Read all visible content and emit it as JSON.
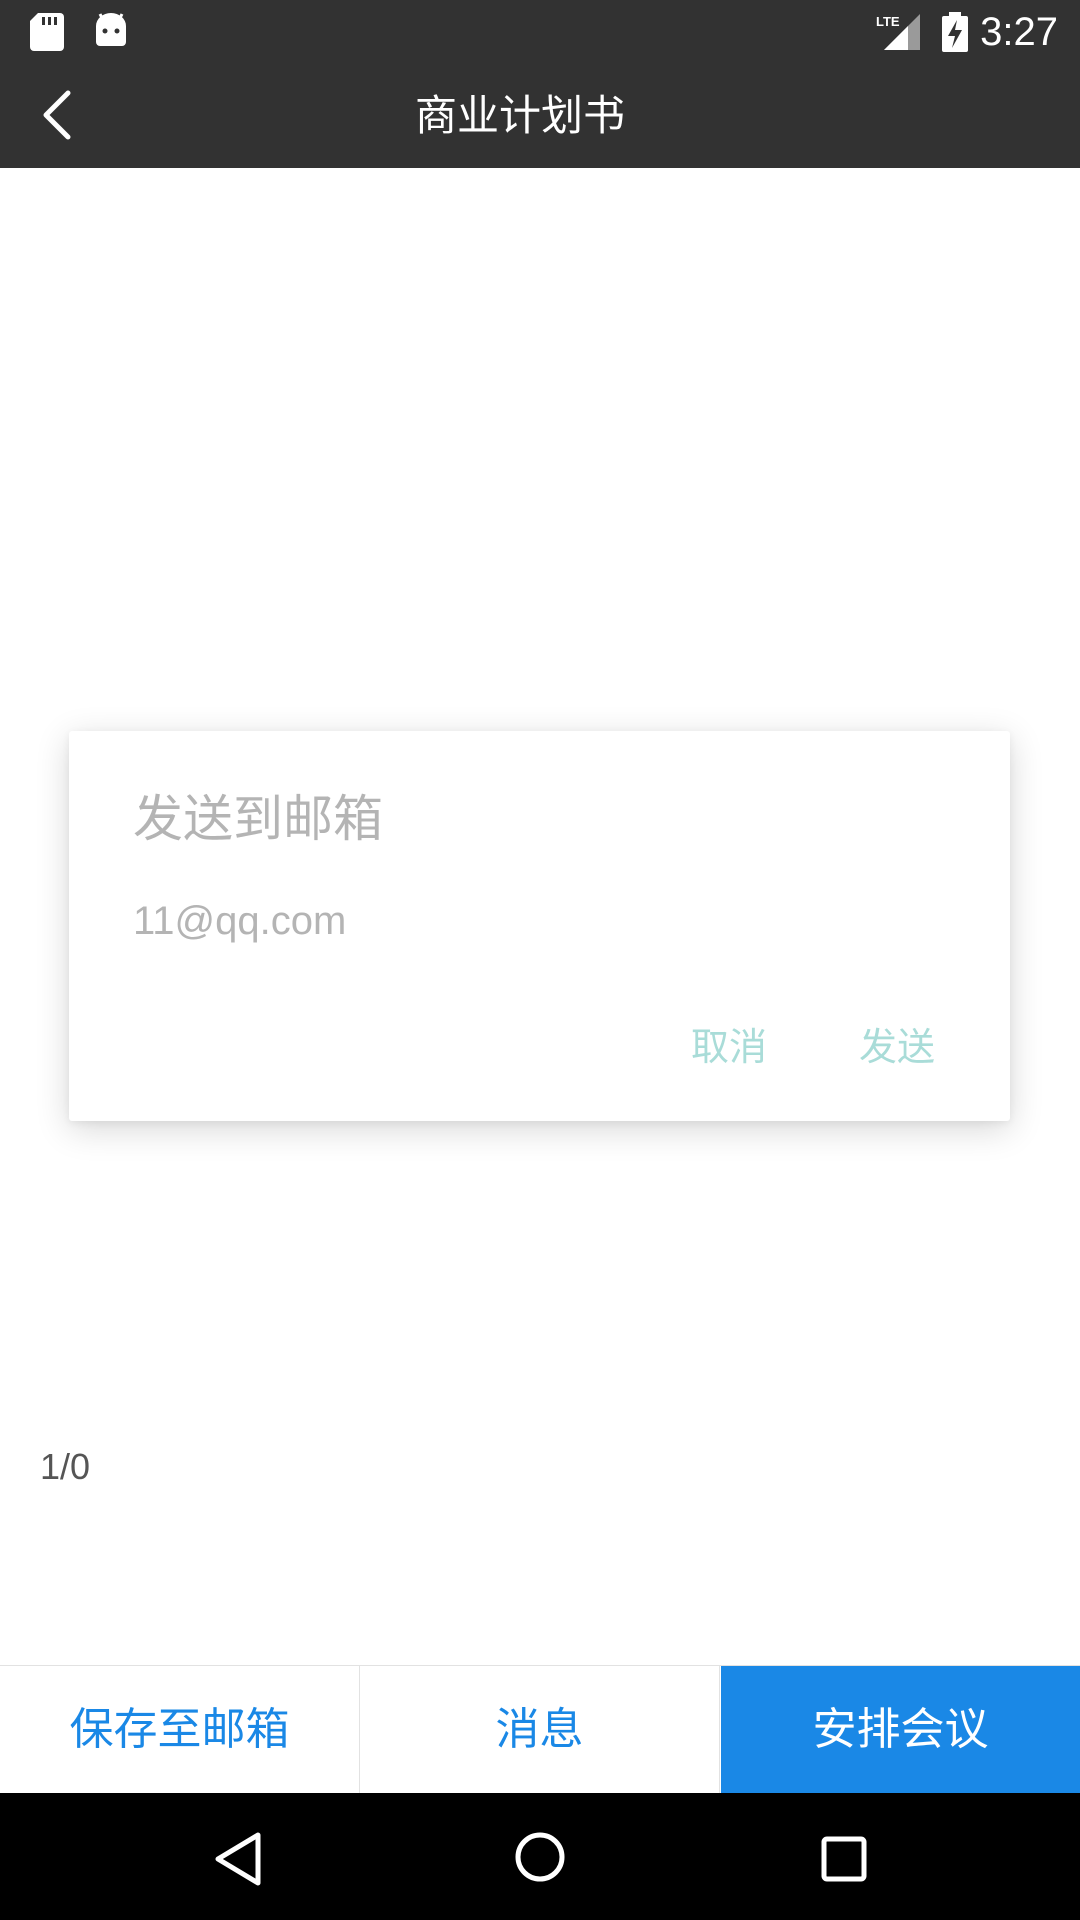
{
  "status_bar": {
    "time": "3:27",
    "network_label": "LTE",
    "icons": [
      "sd-card-icon",
      "android-icon",
      "lte-signal-icon",
      "battery-charging-icon"
    ]
  },
  "app_bar": {
    "title": "商业计划书",
    "back_icon": "chevron-left-icon"
  },
  "dialog": {
    "title": "发送到邮箱",
    "email_value": "11@qq.com",
    "cancel_label": "取消",
    "send_label": "发送"
  },
  "page_indicator": "1/0",
  "bottom_bar": {
    "save_label": "保存至邮箱",
    "message_label": "消息",
    "meeting_label": "安排会议"
  },
  "nav_bar": {
    "icons": [
      "nav-back-icon",
      "nav-home-icon",
      "nav-recent-icon"
    ]
  },
  "colors": {
    "bar_background": "#323232",
    "accent_blue": "#1a88e6",
    "dialog_button": "#a9dcd8",
    "dialog_text": "#b4b4b4"
  }
}
